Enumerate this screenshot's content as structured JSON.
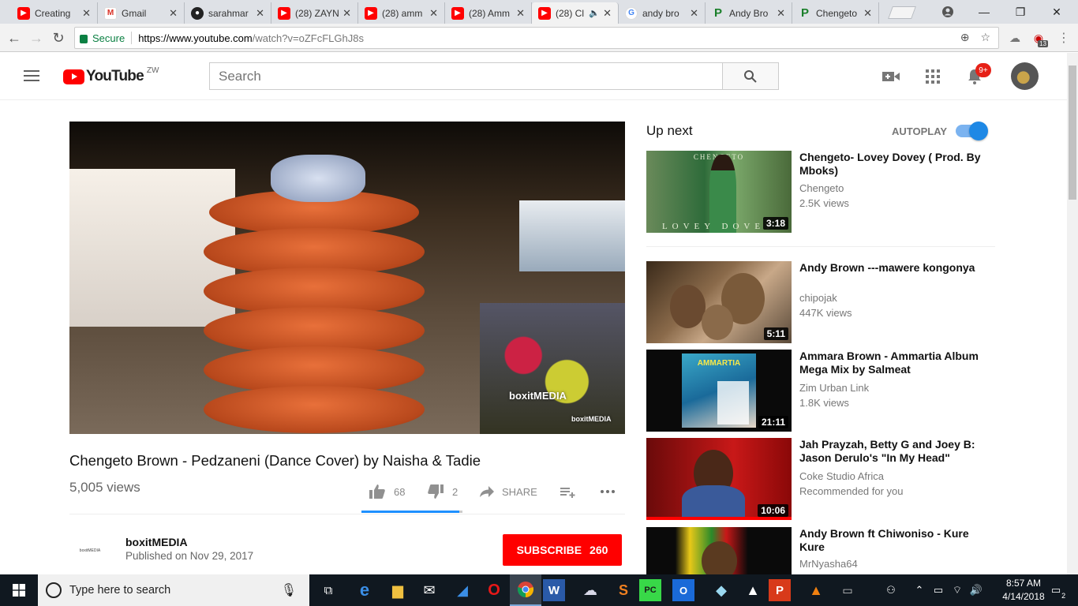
{
  "browser": {
    "tabs": [
      {
        "title": "Creating",
        "favicon": "youtube-icon",
        "active": false
      },
      {
        "title": "Gmail",
        "favicon": "gmail-icon",
        "active": false
      },
      {
        "title": "sarahmar",
        "favicon": "github-icon",
        "active": false
      },
      {
        "title": "(28) ZAYN",
        "favicon": "youtube-icon",
        "active": false
      },
      {
        "title": "(28) amm",
        "favicon": "youtube-icon",
        "active": false
      },
      {
        "title": "(28) Amm",
        "favicon": "youtube-icon",
        "active": false
      },
      {
        "title": "(28) Cl",
        "favicon": "youtube-icon",
        "active": true,
        "audio": true
      },
      {
        "title": "andy bro",
        "favicon": "google-icon",
        "active": false
      },
      {
        "title": "Andy Bro",
        "favicon": "pandora-icon",
        "active": false
      },
      {
        "title": "Chengeto",
        "favicon": "pandora-icon",
        "active": false
      }
    ],
    "secure_label": "Secure",
    "url_host": "https://www.youtube.com",
    "url_path": "/watch?v=oZFcFLGhJ8s",
    "extension_badge": "13"
  },
  "yt": {
    "logo_text": "YouTube",
    "country": "ZW",
    "search_placeholder": "Search",
    "notifications_badge": "9+"
  },
  "video": {
    "title": "Chengeto Brown - Pedzaneni (Dance Cover) by Naisha & Tadie",
    "views": "5,005 views",
    "likes": "68",
    "dislikes": "2",
    "like_fraction": 0.97,
    "share_label": "SHARE",
    "watermark": "boxitMEDIA"
  },
  "channel": {
    "name": "boxitMEDIA",
    "avatar_text": "boxitMEDIA",
    "published": "Published on Nov 29, 2017",
    "subscribe_label": "SUBSCRIBE",
    "subscriber_count": "260"
  },
  "sidebar": {
    "up_next": "Up next",
    "autoplay": "AUTOPLAY",
    "autoplay_on": true,
    "items": [
      {
        "title": "Chengeto- Lovey Dovey ( Prod. By Mboks)",
        "channel": "Chengeto",
        "views": "2.5K views",
        "duration": "3:18",
        "thumb_top_text": "CHENGETO",
        "thumb_bottom_text": "LOVEY DOVEY"
      },
      {
        "title": "Andy Brown ---mawere kongonya",
        "channel": "chipojak",
        "views": "447K views",
        "duration": "5:11"
      },
      {
        "title": "Ammara Brown - Ammartia Album Mega Mix by Salmeat",
        "channel": "Zim Urban Link",
        "views": "1.8K views",
        "duration": "21:11",
        "thumb_top_text": "AMMARTIA"
      },
      {
        "title": "Jah Prayzah, Betty G and Joey B: Jason Derulo's \"In My Head\"",
        "channel": "Coke Studio Africa",
        "views": "Recommended for you",
        "duration": "10:06"
      },
      {
        "title": "Andy Brown ft Chiwoniso - Kure Kure",
        "channel": "MrNyasha64",
        "views": "",
        "duration": ""
      }
    ]
  },
  "taskbar": {
    "search_placeholder": "Type here to search",
    "time": "8:57 AM",
    "date": "4/14/2018",
    "notification_count": "2"
  },
  "colors": {
    "yt_red": "#ff0000",
    "autoplay_blue": "#1e88e5",
    "secure_green": "#0b8043",
    "taskbar": "#101820"
  }
}
